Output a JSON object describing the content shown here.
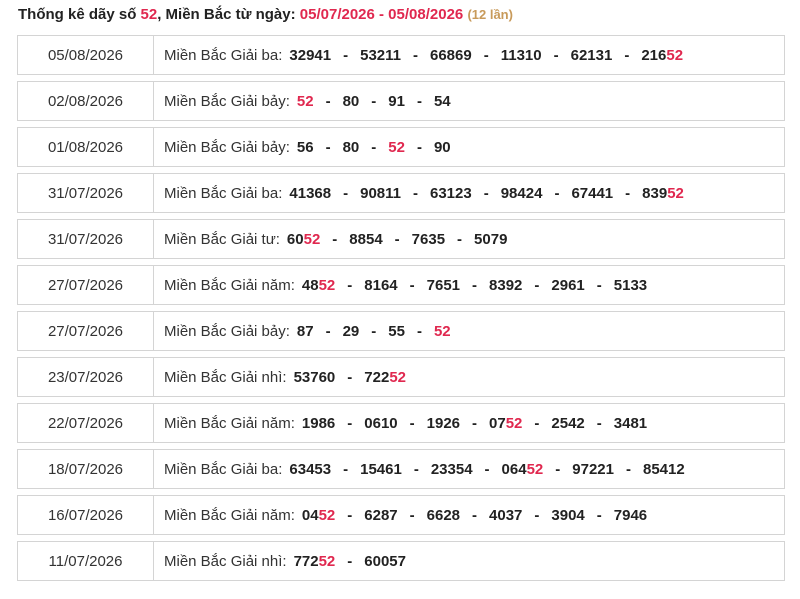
{
  "header": {
    "prefix": "Thống kê dãy số ",
    "number": "52",
    "middle": ", Miền Bắc từ ngày: ",
    "range": "05/07/2026 - 05/08/2026",
    "count": "(12 lần)"
  },
  "separator": "-",
  "rows": [
    {
      "date": "05/08/2026",
      "label": "Miền Bắc Giải ba:",
      "nums": [
        [
          "32941",
          ""
        ],
        [
          "53211",
          ""
        ],
        [
          "66869",
          ""
        ],
        [
          "11310",
          ""
        ],
        [
          "62131",
          ""
        ],
        [
          "216",
          "52"
        ]
      ]
    },
    {
      "date": "02/08/2026",
      "label": "Miền Bắc Giải bảy:",
      "nums": [
        [
          "",
          "52"
        ],
        [
          "80",
          ""
        ],
        [
          "91",
          ""
        ],
        [
          "54",
          ""
        ]
      ]
    },
    {
      "date": "01/08/2026",
      "label": "Miền Bắc Giải bảy:",
      "nums": [
        [
          "56",
          ""
        ],
        [
          "80",
          ""
        ],
        [
          "",
          "52"
        ],
        [
          "90",
          ""
        ]
      ]
    },
    {
      "date": "31/07/2026",
      "label": "Miền Bắc Giải ba:",
      "nums": [
        [
          "41368",
          ""
        ],
        [
          "90811",
          ""
        ],
        [
          "63123",
          ""
        ],
        [
          "98424",
          ""
        ],
        [
          "67441",
          ""
        ],
        [
          "839",
          "52"
        ]
      ]
    },
    {
      "date": "31/07/2026",
      "label": "Miền Bắc Giải tư:",
      "nums": [
        [
          "60",
          "52"
        ],
        [
          "8854",
          ""
        ],
        [
          "7635",
          ""
        ],
        [
          "5079",
          ""
        ]
      ]
    },
    {
      "date": "27/07/2026",
      "label": "Miền Bắc Giải năm:",
      "nums": [
        [
          "48",
          "52"
        ],
        [
          "8164",
          ""
        ],
        [
          "7651",
          ""
        ],
        [
          "8392",
          ""
        ],
        [
          "2961",
          ""
        ],
        [
          "5133",
          ""
        ]
      ]
    },
    {
      "date": "27/07/2026",
      "label": "Miền Bắc Giải bảy:",
      "nums": [
        [
          "87",
          ""
        ],
        [
          "29",
          ""
        ],
        [
          "55",
          ""
        ],
        [
          "",
          "52"
        ]
      ]
    },
    {
      "date": "23/07/2026",
      "label": "Miền Bắc Giải nhì:",
      "nums": [
        [
          "53760",
          ""
        ],
        [
          "722",
          "52"
        ]
      ]
    },
    {
      "date": "22/07/2026",
      "label": "Miền Bắc Giải năm:",
      "nums": [
        [
          "1986",
          ""
        ],
        [
          "0610",
          ""
        ],
        [
          "1926",
          ""
        ],
        [
          "07",
          "52"
        ],
        [
          "2542",
          ""
        ],
        [
          "3481",
          ""
        ]
      ]
    },
    {
      "date": "18/07/2026",
      "label": "Miền Bắc Giải ba:",
      "nums": [
        [
          "63453",
          ""
        ],
        [
          "15461",
          ""
        ],
        [
          "23354",
          ""
        ],
        [
          "064",
          "52"
        ],
        [
          "97221",
          ""
        ],
        [
          "85412",
          ""
        ]
      ]
    },
    {
      "date": "16/07/2026",
      "label": "Miền Bắc Giải năm:",
      "nums": [
        [
          "04",
          "52"
        ],
        [
          "6287",
          ""
        ],
        [
          "6628",
          ""
        ],
        [
          "4037",
          ""
        ],
        [
          "3904",
          ""
        ],
        [
          "7946",
          ""
        ]
      ]
    },
    {
      "date": "11/07/2026",
      "label": "Miền Bắc Giải nhì:",
      "nums": [
        [
          "772",
          "52"
        ],
        [
          "60057",
          ""
        ]
      ]
    }
  ]
}
